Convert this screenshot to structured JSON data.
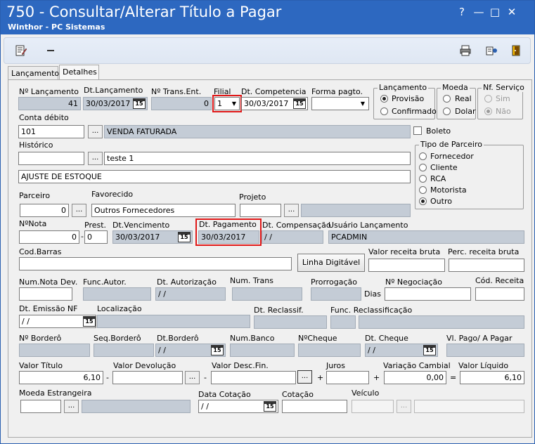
{
  "window": {
    "title": "750 - Consultar/Alterar Título a Pagar",
    "subtitle": "Winthor - PC Sistemas",
    "help": "?",
    "minimize": "—",
    "maximize": "□",
    "close": "✕"
  },
  "tabs": [
    "Lançamentos",
    "Detalhes"
  ],
  "labels": {
    "num_lancamento": "Nº Lançamento",
    "dt_lancamento": "Dt.Lançamento",
    "num_trans_ent": "Nº Trans.Ent.",
    "filial": "Filial",
    "dt_competencia": "Dt. Competencia",
    "forma_pagto": "Forma pagto.",
    "conta_debito": "Conta débito",
    "historico": "Histórico",
    "boleto": "Boleto",
    "parceiro": "Parceiro",
    "favorecido": "Favorecido",
    "projeto": "Projeto",
    "num_nota": "NºNota",
    "prest": "Prest.",
    "dt_vencimento": "Dt.Vencimento",
    "dt_pagamento": "Dt. Pagamento",
    "dt_compensacao": "Dt. Compensação",
    "usuario_lancamento": "Usuário Lançamento",
    "cod_barras": "Cod.Barras",
    "linha_digitavel": "Linha Digitável",
    "valor_receita_bruta": "Valor receita bruta",
    "perc_receita_bruta": "Perc. receita bruta",
    "num_nota_dev": "Num.Nota Dev.",
    "func_autor": "Func.Autor.",
    "dt_autorizacao": "Dt. Autorização",
    "num_trans": "Num. Trans",
    "prorrogacao": "Prorrogação",
    "dias": "Dias",
    "num_negociacao": "Nº Negociação",
    "cod_receita": "Cód. Receita",
    "dt_emissao_nf": "Dt. Emissão NF",
    "localizacao": "Localização",
    "dt_reclassif": "Dt. Reclassif.",
    "func_reclassificacao": "Func. Reclassificação",
    "num_bordero": "Nº Borderô",
    "seq_bordero": "Seq.Borderô",
    "dt_bordero": "Dt.Borderô",
    "num_banco": "Num.Banco",
    "num_cheque": "NºCheque",
    "dt_cheque": "Dt. Cheque",
    "vl_pago": "Vl. Pago/ A Pagar",
    "valor_titulo": "Valor Título",
    "valor_devolucao": "Valor Devolução",
    "valor_desc_fin": "Valor Desc.Fin.",
    "juros": "Juros",
    "variacao_cambial": "Variação Cambial",
    "valor_liquido": "Valor Líquido",
    "moeda_estrangeira": "Moeda Estrangeira",
    "data_cotacao": "Data Cotação",
    "cotacao": "Cotação",
    "veiculo": "Veículo"
  },
  "values": {
    "num_lancamento": "41",
    "dt_lancamento": "30/03/2017",
    "num_trans_ent": "0",
    "filial": "1",
    "dt_competencia": "30/03/2017",
    "forma_pagto": "",
    "conta_debito_code": "101",
    "conta_debito_desc": "VENDA FATURADA",
    "historico_code": "",
    "historico_text": "teste 1",
    "historico_2": "AJUSTE DE ESTOQUE",
    "parceiro": "0",
    "favorecido": "Outros Fornecedores",
    "projeto": "",
    "num_nota": "0",
    "prest": "0",
    "dt_vencimento": "30/03/2017",
    "dt_pagamento": "30/03/2017",
    "dt_compensacao": "/ /",
    "usuario_lancamento": "PCADMIN",
    "cod_barras": "",
    "dt_autorizacao": "/ /",
    "dt_emissao_nf": "/ /",
    "dt_bordero": "/ /",
    "dt_cheque": "/ /",
    "valor_titulo": "6,10",
    "variacao_cambial": "0,00",
    "valor_liquido": "6,10",
    "data_cotacao": "/ /"
  },
  "ops": {
    "minus1": "-",
    "minus2": "-",
    "plus1": "+",
    "plus2": "+",
    "equals": "=",
    "dash_prest": "-"
  },
  "ellipsis": "...",
  "cal_text": "15",
  "lancamento_group": {
    "title": "Lançamento",
    "options": [
      "Provisão",
      "Confirmado"
    ],
    "selected": "Provisão"
  },
  "moeda_group": {
    "title": "Moeda",
    "options": [
      "Real",
      "Dolar"
    ],
    "selected": ""
  },
  "nf_servico_group": {
    "title": "Nf. Serviço",
    "options": [
      "Sim",
      "Não"
    ],
    "selected": "Não"
  },
  "tipo_parceiro_group": {
    "title": "Tipo de Parceiro",
    "options": [
      "Fornecedor",
      "Cliente",
      "RCA",
      "Motorista",
      "Outro"
    ],
    "selected": "Outro"
  },
  "icons": {
    "toolbar": [
      "edit-doc-icon",
      "minus-icon",
      "print-icon",
      "settings-icon",
      "exit-door-icon"
    ]
  },
  "colors": {
    "titlebar": "#2d68c0",
    "readonly_field": "#c4ccd6",
    "highlight": "#e01818"
  }
}
